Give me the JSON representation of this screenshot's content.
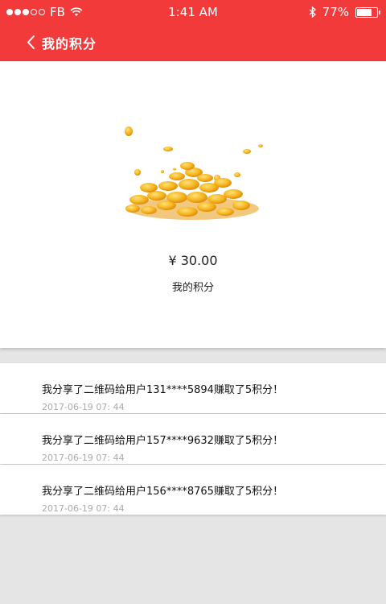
{
  "status_bar": {
    "carrier": "FB",
    "time": "1:41 AM",
    "battery_percent": "77%",
    "battery_level": 0.77,
    "icons": [
      "signal-dots-icon",
      "wifi-icon",
      "bluetooth-icon",
      "battery-icon"
    ]
  },
  "nav": {
    "title": "我的积分",
    "back_icon": "chevron-left-icon"
  },
  "summary": {
    "amount": "¥ 30.00",
    "label": "我的积分",
    "illustration": "gold-coins-pile"
  },
  "records": [
    {
      "text": "我分享了二维码给用户131****5894赚取了5积分！",
      "time": "2017-06-19  07: 44"
    },
    {
      "text": "我分享了二维码给用户157****9632赚取了5积分！",
      "time": "2017-06-19  07: 44"
    },
    {
      "text": "我分享了二维码给用户156****8765赚取了5积分！",
      "time": "2017-06-19  07: 44"
    }
  ],
  "colors": {
    "header_red": "#f23a3a",
    "background": "#e5e5e5",
    "coin_gold": "#f5b31a"
  }
}
